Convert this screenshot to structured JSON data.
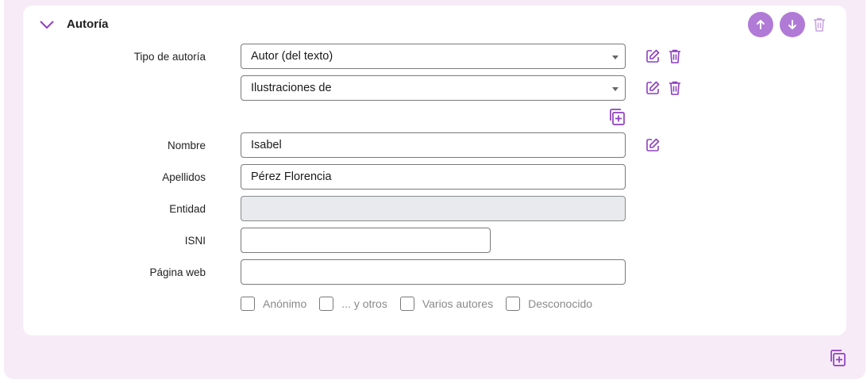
{
  "section": {
    "title": "Autoría"
  },
  "fields": {
    "tipo_label": "Tipo de autoría",
    "tipo_values": [
      "Autor (del texto)",
      "Ilustraciones de"
    ],
    "nombre_label": "Nombre",
    "nombre_value": "Isabel",
    "apellidos_label": "Apellidos",
    "apellidos_value": "Pérez Florencia",
    "entidad_label": "Entidad",
    "entidad_value": "",
    "isni_label": "ISNI",
    "isni_value": "",
    "web_label": "Página web",
    "web_value": ""
  },
  "checkboxes": [
    "Anónimo",
    "... y otros",
    "Varios autores",
    "Desconocido"
  ],
  "icons": {
    "collapse": "chevron-down-icon",
    "move_up": "arrow-up-icon",
    "move_down": "arrow-down-icon",
    "delete": "trash-icon",
    "edit": "pencil-square-icon",
    "add": "copy-plus-icon"
  },
  "colors": {
    "accent": "#8e3fbf",
    "accent_light": "#b07ad6",
    "background": "#f7ebf7"
  }
}
